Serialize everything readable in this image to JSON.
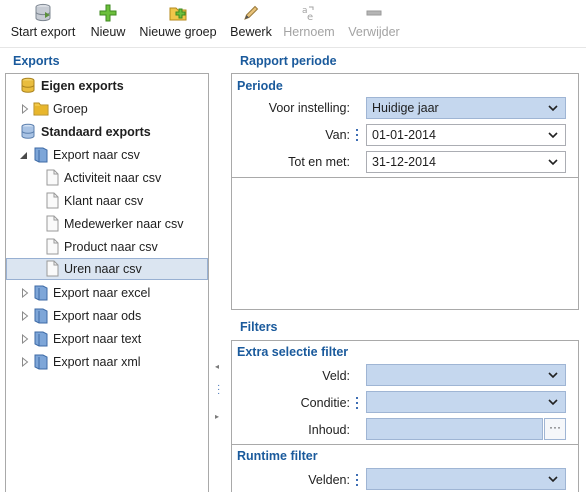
{
  "toolbar": {
    "buttons": [
      {
        "label": "Start export",
        "icon": "database-export-icon",
        "enabled": true
      },
      {
        "label": "Nieuw",
        "icon": "plus-icon",
        "enabled": true
      },
      {
        "label": "Nieuwe groep",
        "icon": "new-folder-icon",
        "enabled": true
      },
      {
        "label": "Bewerk",
        "icon": "pencil-icon",
        "enabled": true
      },
      {
        "label": "Hernoem",
        "icon": "rename-icon",
        "enabled": false
      },
      {
        "label": "Verwijder",
        "icon": "minus-icon",
        "enabled": false
      }
    ]
  },
  "left": {
    "title": "Exports",
    "tree": [
      {
        "label": "Eigen exports",
        "icon": "database-icon",
        "bold": true
      },
      {
        "label": "Groep",
        "icon": "folder-icon",
        "expand": "collapsed"
      },
      {
        "label": "Standaard exports",
        "icon": "database-icon",
        "bold": true
      },
      {
        "label": "Export naar csv",
        "icon": "book-icon",
        "expand": "expanded"
      },
      {
        "label": "Activiteit naar csv",
        "icon": "document-icon"
      },
      {
        "label": "Klant naar csv",
        "icon": "document-icon"
      },
      {
        "label": "Medewerker naar csv",
        "icon": "document-icon"
      },
      {
        "label": "Product naar csv",
        "icon": "document-icon"
      },
      {
        "label": "Uren naar csv",
        "icon": "document-icon",
        "selected": true
      },
      {
        "label": "Export naar excel",
        "icon": "book-icon",
        "expand": "collapsed"
      },
      {
        "label": "Export naar ods",
        "icon": "book-icon",
        "expand": "collapsed"
      },
      {
        "label": "Export naar text",
        "icon": "book-icon",
        "expand": "collapsed"
      },
      {
        "label": "Export naar xml",
        "icon": "book-icon",
        "expand": "collapsed"
      }
    ]
  },
  "rapport": {
    "title": "Rapport periode",
    "periode": {
      "title": "Periode",
      "voor_instelling_label": "Voor instelling:",
      "voor_instelling_value": "Huidige jaar",
      "van_label": "Van:",
      "van_value": "01-01-2014",
      "tot_label": "Tot en met:",
      "tot_value": "31-12-2014"
    }
  },
  "filters": {
    "title": "Filters",
    "extra": {
      "title": "Extra selectie filter",
      "veld_label": "Veld:",
      "veld_value": "",
      "conditie_label": "Conditie:",
      "conditie_value": "",
      "inhoud_label": "Inhoud:",
      "inhoud_value": "",
      "inhoud_button": "···"
    },
    "runtime": {
      "title": "Runtime filter",
      "velden_label": "Velden:",
      "velden_value": ""
    }
  },
  "colors": {
    "heading_blue": "#1a5a9c",
    "field_blue": "#c5d7ee",
    "selection_bg": "#dbe5f1"
  }
}
